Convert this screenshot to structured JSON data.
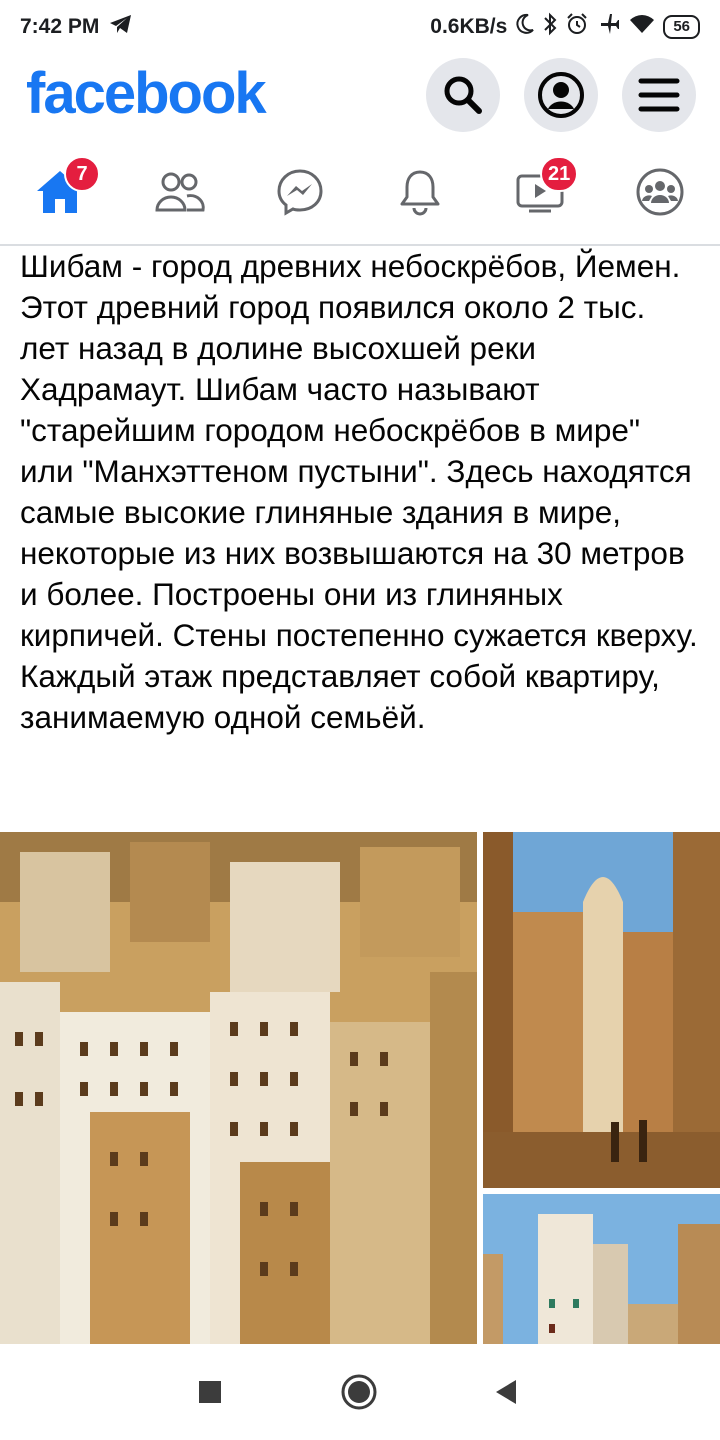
{
  "status_bar": {
    "time": "7:42 PM",
    "net_speed": "0.6KB/s",
    "battery": "56",
    "icons": [
      "telegram-icon",
      "moon-icon",
      "bluetooth-icon",
      "alarm-icon",
      "airplane-icon",
      "wifi-icon",
      "battery-icon"
    ]
  },
  "header": {
    "logo": "facebook",
    "icons": [
      "search-icon",
      "profile-icon",
      "menu-icon"
    ]
  },
  "nav": {
    "items": [
      {
        "name": "home",
        "icon": "home-icon",
        "badge": "7",
        "active": true
      },
      {
        "name": "friends",
        "icon": "friends-icon",
        "badge": null
      },
      {
        "name": "messenger",
        "icon": "messenger-icon",
        "badge": null
      },
      {
        "name": "notifications",
        "icon": "bell-icon",
        "badge": null
      },
      {
        "name": "watch",
        "icon": "video-icon",
        "badge": "21"
      },
      {
        "name": "groups",
        "icon": "groups-icon",
        "badge": null
      }
    ],
    "accent_color": "#1877f2",
    "badge_color": "#e41e3f"
  },
  "post": {
    "text": "Шибам - город древних небоскрёбов, Йемен. Этот древний город появился около 2 тыс. лет назад в долине высохшей реки Хадрамаут. Шибам часто называют \"старейшим городом небоскрёбов в мире\" или \"Манхэттеном пустыни\". Здесь находятся самые высокие глиняные здания в мире, некоторые из них возвышаются на 30 метров и более. Построены они из глиняных кирпичей. Стены постепенно сужается кверху. Каждый этаж представляет собой квартиру, занимаемую одной семьёй.",
    "photos": [
      "city-skyline-photo",
      "street-mosque-photo",
      "tower-sky-photo"
    ]
  },
  "android_nav": {
    "icons": [
      "recents-square-icon",
      "home-circle-icon",
      "back-triangle-icon"
    ]
  }
}
